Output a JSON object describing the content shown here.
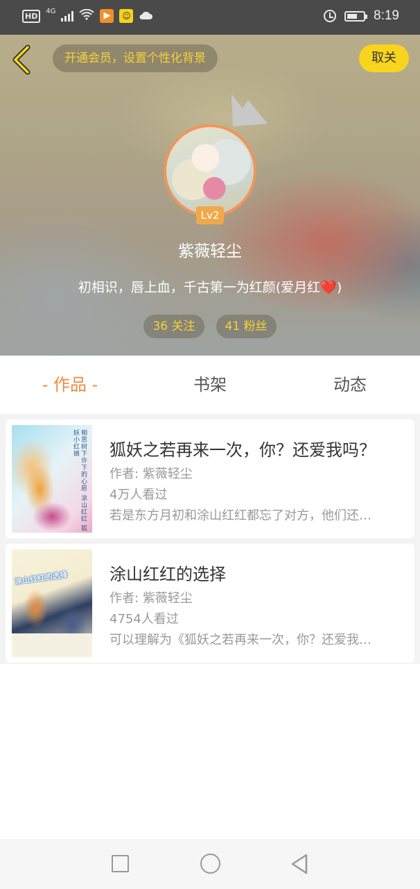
{
  "status_bar": {
    "hd": "HD",
    "network": "4G",
    "time": "8:19",
    "icons": [
      "signal-icon",
      "wifi-icon",
      "app-notification-icon",
      "app-notification-icon",
      "cloud-icon",
      "alarm-icon",
      "battery-icon"
    ]
  },
  "header": {
    "vip_prompt": "开通会员，设置个性化背景",
    "close_label": "取关",
    "level": "Lv2",
    "username": "紫薇轻尘",
    "signature": "初相识，唇上血，千古第一为红颜(爱月红",
    "signature_emoji": "❤️",
    "signature_tail": ")",
    "following": "36 关注",
    "followers": "41 粉丝",
    "accent_color": "#f8d51c"
  },
  "tabs": [
    {
      "label": "- 作品 -",
      "active": true
    },
    {
      "label": "书架",
      "active": false
    },
    {
      "label": "动态",
      "active": false
    }
  ],
  "works": [
    {
      "title": "狐妖之若再来一次，你？还爱我吗？",
      "author": "作者: 紫薇轻尘",
      "views": "4万人看过",
      "desc": "若是东方月初和涂山红红都忘了对方，他们还…",
      "cover_text": "相思树下许下的心愿 涂山红红 狐妖小红娘"
    },
    {
      "title": "涂山红红的选择",
      "author": "作者: 紫薇轻尘",
      "views": "4754人看过",
      "desc": "可以理解为《狐妖之若再来一次，你？还爱我…",
      "cover_text": "涂山红红的选择"
    }
  ],
  "nav": {
    "icons": [
      "recent-apps-icon",
      "home-icon",
      "back-icon"
    ]
  }
}
